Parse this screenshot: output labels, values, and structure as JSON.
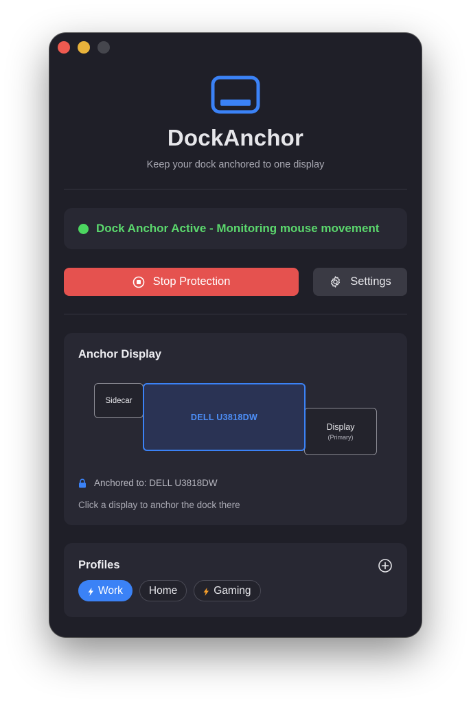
{
  "app": {
    "title": "DockAnchor",
    "subtitle": "Keep your dock anchored to one display",
    "icon": "dock-monitor-icon",
    "accent_color": "#3b82f6"
  },
  "status": {
    "text": "Dock Anchor Active - Monitoring mouse movement",
    "color": "#5bd86d"
  },
  "actions": {
    "stop_label": "Stop Protection",
    "stop_icon": "stop-circle-icon",
    "settings_label": "Settings",
    "settings_icon": "gear-icon"
  },
  "anchor_display": {
    "title": "Anchor Display",
    "displays": [
      {
        "name": "Sidecar",
        "sub": "",
        "selected": false
      },
      {
        "name": "DELL U3818DW",
        "sub": "",
        "selected": true
      },
      {
        "name": "Display",
        "sub": "(Primary)",
        "selected": false
      }
    ],
    "anchored_label": "Anchored to: DELL U3818DW",
    "hint": "Click a display to anchor the dock there"
  },
  "profiles": {
    "title": "Profiles",
    "add_icon": "plus-circle-icon",
    "items": [
      {
        "label": "Work",
        "icon": "bolt-icon",
        "active": true
      },
      {
        "label": "Home",
        "icon": "",
        "active": false
      },
      {
        "label": "Gaming",
        "icon": "bolt-icon",
        "active": false
      }
    ]
  }
}
